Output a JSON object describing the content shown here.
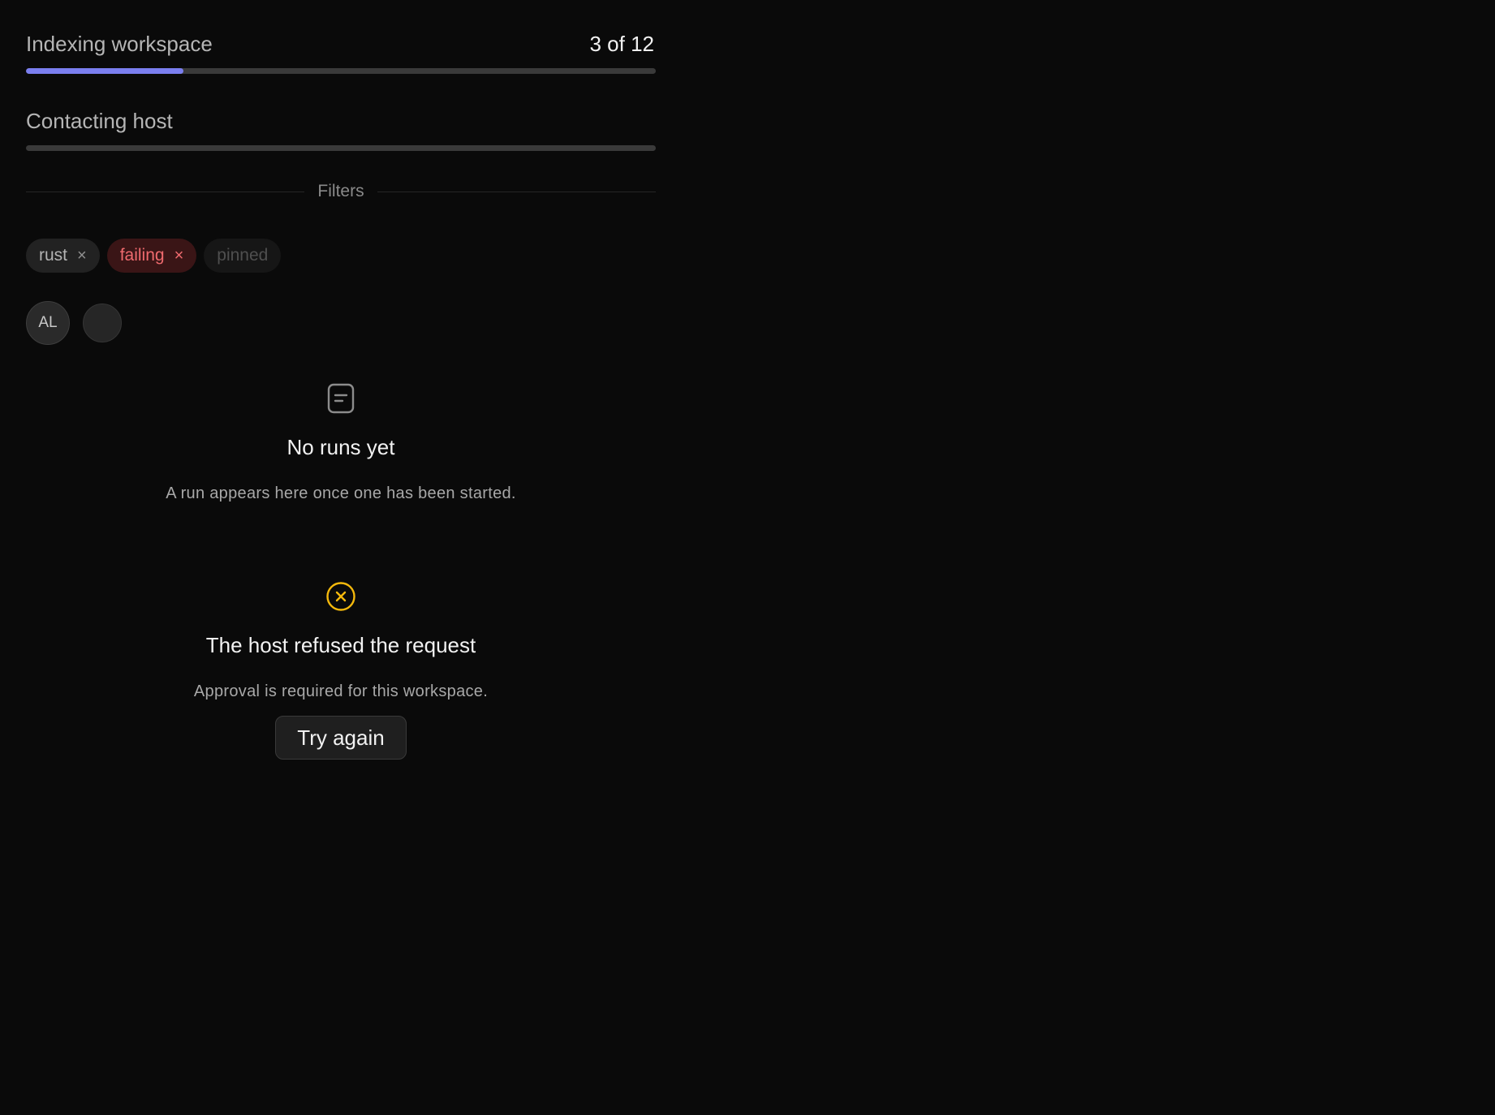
{
  "colors": {
    "background": "#0a0a0a",
    "progress_fill": "#7b7ff0",
    "track": "#3a3a3a",
    "error_accent": "#f5b90c",
    "chip_failing_text": "#ef6a6e"
  },
  "progress": [
    {
      "title": "Indexing workspace",
      "count": "3 of 12",
      "fraction": 0.25
    },
    {
      "title": "Contacting host",
      "count": "",
      "fraction": 0
    }
  ],
  "filters": {
    "label": "Filters",
    "chips": [
      {
        "label": "rust",
        "remove": "×",
        "state": "active"
      },
      {
        "label": "failing",
        "remove": "×",
        "state": "error"
      },
      {
        "label": "pinned",
        "remove": "",
        "state": "disabled"
      }
    ]
  },
  "avatars": [
    {
      "initials": "AL"
    },
    {
      "initials": ""
    }
  ],
  "empty_state": {
    "icon": "document-icon",
    "title": "No runs yet",
    "description": "A run appears here once one has been started."
  },
  "error_state": {
    "icon": "x-circle-icon",
    "title": "The host refused the request",
    "description": "Approval is required for this workspace.",
    "action_label": "Try again"
  }
}
